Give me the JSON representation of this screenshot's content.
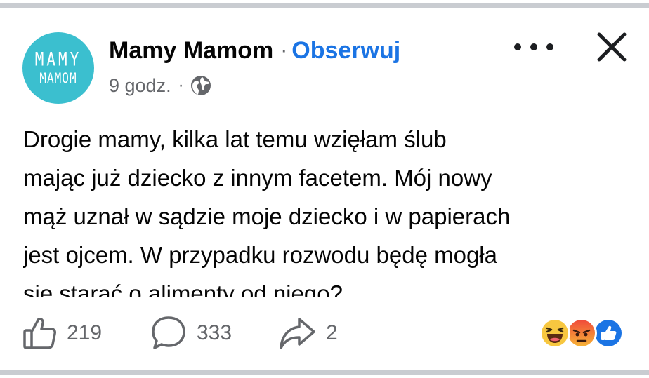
{
  "page": {
    "avatar_text_line1": "MAMY",
    "avatar_text_line2": "MAMOM",
    "name": "Mamy Mamom",
    "separator": "·",
    "follow_label": "Obserwuj"
  },
  "meta": {
    "time": "9 godz.",
    "separator": "·",
    "audience_icon": "globe-icon"
  },
  "header_actions": {
    "more_icon": "more-options-icon",
    "close_icon": "close-icon"
  },
  "post": {
    "text": "Drogie mamy, kilka lat temu wzięłam ślub\nmając już dziecko z innym facetem. Mój nowy\nmąż uznał w sądzie moje dziecko i w papierach\njest ojcem. W przypadku rozwodu będę mogła\nsie starać o alimenty od niego?"
  },
  "actions": {
    "likes": "219",
    "comments": "333",
    "shares": "2"
  },
  "reactions": [
    "haha-reaction-icon",
    "angry-reaction-icon",
    "like-reaction-icon"
  ],
  "colors": {
    "accent": "#1b74e4",
    "secondary_text": "#65676b",
    "avatar_bg": "#3bbfcf",
    "divider": "#c9ccd1"
  }
}
